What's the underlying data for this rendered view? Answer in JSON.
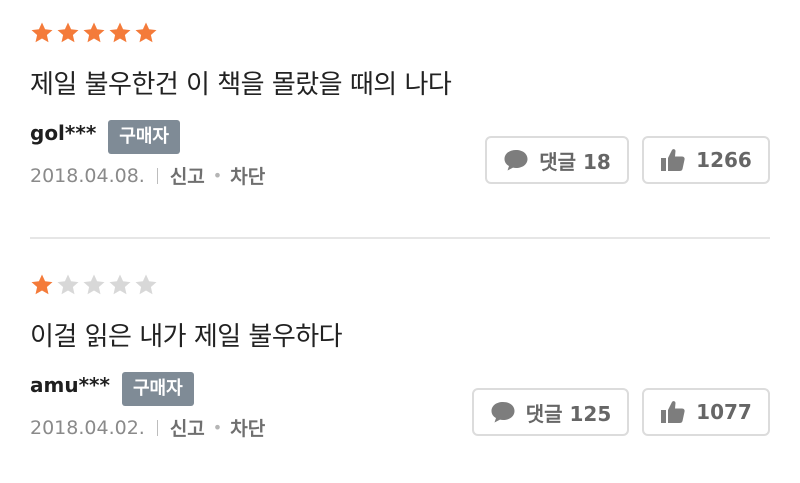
{
  "colors": {
    "star_filled": "#f47b3a",
    "star_empty": "#d8d8d8",
    "badge": "#7f8b96",
    "icon": "#7d7d7d"
  },
  "reviews": [
    {
      "rating": 5,
      "max_rating": 5,
      "text": "제일 불우한건 이 책을 몰랐을 때의 나다",
      "username": "gol***",
      "badge": "구매자",
      "date": "2018.04.08.",
      "report_label": "신고",
      "block_label": "차단",
      "comment_label": "댓글 18",
      "like_count": "1266",
      "comment_icon": "speech-bubble-icon",
      "like_icon": "thumbs-up-icon"
    },
    {
      "rating": 1,
      "max_rating": 5,
      "text": "이걸 읽은 내가 제일 불우하다",
      "username": "amu***",
      "badge": "구매자",
      "date": "2018.04.02.",
      "report_label": "신고",
      "block_label": "차단",
      "comment_label": "댓글 125",
      "like_count": "1077",
      "comment_icon": "speech-bubble-icon",
      "like_icon": "thumbs-up-icon"
    }
  ]
}
